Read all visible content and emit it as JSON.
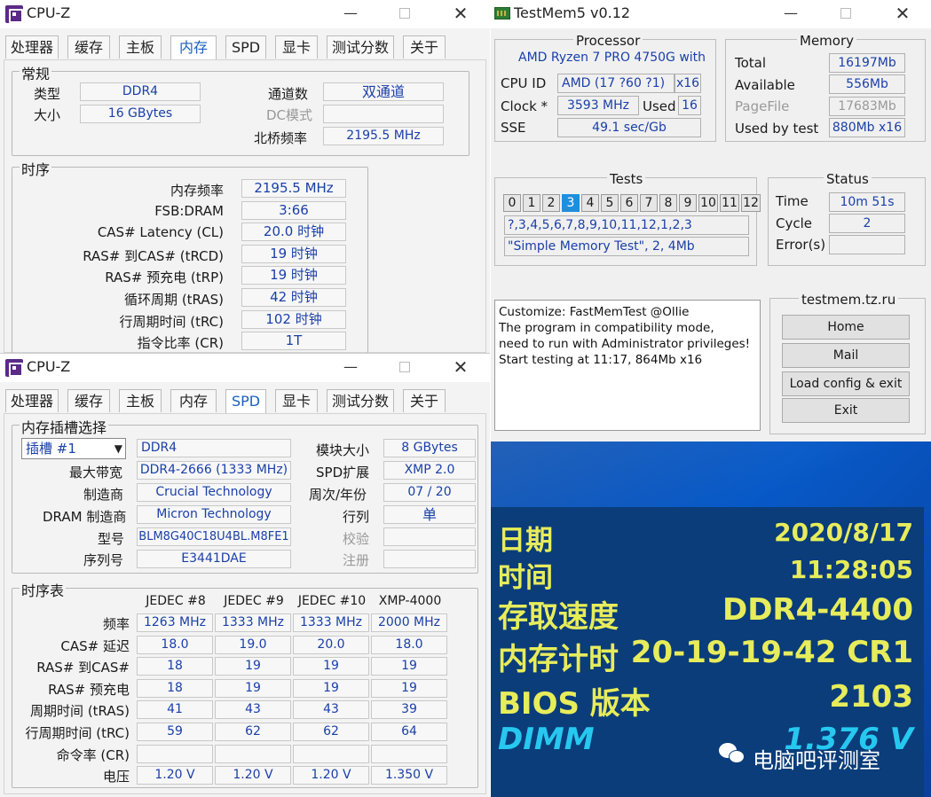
{
  "cpuz1": {
    "title": "CPU-Z",
    "tabs": [
      "处理器",
      "缓存",
      "主板",
      "内存",
      "SPD",
      "显卡",
      "测试分数",
      "关于"
    ],
    "general": {
      "label": "常规",
      "type_label": "类型",
      "type": "DDR4",
      "size_label": "大小",
      "size": "16 GBytes",
      "channels_label": "通道数",
      "channels": "双通道",
      "dc_label": "DC模式",
      "dc": "",
      "nb_label": "北桥频率",
      "nb": "2195.5 MHz"
    },
    "timings": {
      "label": "时序",
      "rows": [
        {
          "label": "内存频率",
          "value": "2195.5 MHz"
        },
        {
          "label": "FSB:DRAM",
          "value": "3:66"
        },
        {
          "label": "CAS# Latency (CL)",
          "value": "20.0 时钟"
        },
        {
          "label": "RAS# 到CAS# (tRCD)",
          "value": "19 时钟"
        },
        {
          "label": "RAS# 预充电 (tRP)",
          "value": "19 时钟"
        },
        {
          "label": "循环周期 (tRAS)",
          "value": "42 时钟"
        },
        {
          "label": "行周期时间 (tRC)",
          "value": "102 时钟"
        },
        {
          "label": "指令比率 (CR)",
          "value": "1T"
        }
      ]
    }
  },
  "cpuz2": {
    "title": "CPU-Z",
    "tabs": [
      "处理器",
      "缓存",
      "主板",
      "内存",
      "SPD",
      "显卡",
      "测试分数",
      "关于"
    ],
    "slot": {
      "label": "内存插槽选择",
      "select": "插槽 #1",
      "type": "DDR4",
      "module_size_label": "模块大小",
      "module_size": "8 GBytes",
      "max_bw_label": "最大带宽",
      "max_bw": "DDR4-2666 (1333 MHz)",
      "spd_ext_label": "SPD扩展",
      "spd_ext": "XMP 2.0",
      "maker_label": "制造商",
      "maker": "Crucial Technology",
      "week_label": "周次/年份",
      "week": "07 / 20",
      "dram_maker_label": "DRAM 制造商",
      "dram_maker": "Micron Technology",
      "rank_label": "行列",
      "rank": "单",
      "part_label": "型号",
      "part": "BLM8G40C18U4BL.M8FE1",
      "check_label": "校验",
      "check": "",
      "serial_label": "序列号",
      "serial": "E3441DAE",
      "reg_label": "注册",
      "reg": ""
    },
    "table": {
      "label": "时序表",
      "headers": [
        "JEDEC #8",
        "JEDEC #9",
        "JEDEC #10",
        "XMP-4000"
      ],
      "rows": [
        {
          "label": "频率",
          "values": [
            "1263 MHz",
            "1333 MHz",
            "1333 MHz",
            "2000 MHz"
          ]
        },
        {
          "label": "CAS# 延迟",
          "values": [
            "18.0",
            "19.0",
            "20.0",
            "18.0"
          ]
        },
        {
          "label": "RAS# 到CAS#",
          "values": [
            "18",
            "19",
            "19",
            "19"
          ]
        },
        {
          "label": "RAS# 预充电",
          "values": [
            "18",
            "19",
            "19",
            "19"
          ]
        },
        {
          "label": "周期时间 (tRAS)",
          "values": [
            "41",
            "43",
            "43",
            "39"
          ]
        },
        {
          "label": "行周期时间 (tRC)",
          "values": [
            "59",
            "62",
            "62",
            "64"
          ]
        },
        {
          "label": "命令率 (CR)",
          "values": [
            "",
            "",
            "",
            ""
          ]
        },
        {
          "label": "电压",
          "values": [
            "1.20 V",
            "1.20 V",
            "1.20 V",
            "1.350 V"
          ]
        }
      ]
    }
  },
  "testmem": {
    "title": "TestMem5 v0.12",
    "processor": {
      "label": "Processor",
      "name": "AMD Ryzen 7 PRO 4750G with",
      "cpuid_label": "CPU ID",
      "cpuid": "AMD  (17 ?60 ?1)",
      "threads": "x16",
      "clock_label": "Clock *",
      "clock": "3593 MHz",
      "used_label": "Used",
      "used": "16",
      "sse_label": "SSE",
      "sse": "49.1 sec/Gb"
    },
    "memory": {
      "label": "Memory",
      "total_label": "Total",
      "total": "16197Mb",
      "available_label": "Available",
      "available": "556Mb",
      "pagefile_label": "PageFile",
      "pagefile": "17683Mb",
      "usedby_label": "Used by test",
      "usedby": "880Mb x16"
    },
    "tests": {
      "label": "Tests",
      "cells": [
        "0",
        "1",
        "2",
        "3",
        "4",
        "5",
        "6",
        "7",
        "8",
        "9",
        "10",
        "11",
        "12"
      ],
      "active": "3",
      "sequence": "?,3,4,5,6,7,8,9,10,11,12,1,2,3",
      "current": "\"Simple Memory Test\", 2, 4Mb"
    },
    "status": {
      "label": "Status",
      "time_label": "Time",
      "time": "10m 51s",
      "cycle_label": "Cycle",
      "cycle": "2",
      "errors_label": "Error(s)",
      "errors": ""
    },
    "log": [
      "Customize: FastMemTest @Ollie",
      "The program in compatibility mode,",
      "need to run with Administrator privileges!",
      "Start testing at 11:17, 864Mb x16"
    ],
    "site": {
      "label": "testmem.tz.ru",
      "buttons": [
        "Home",
        "Mail",
        "Load config & exit",
        "Exit"
      ]
    }
  },
  "sysinfo": [
    {
      "key": "日期",
      "value": "2020/8/17"
    },
    {
      "key": "时间",
      "value": "11:28:05"
    },
    {
      "key": "存取速度",
      "value": "DDR4-4400"
    },
    {
      "key": "内存计时",
      "value": "20-19-19-42 CR1"
    },
    {
      "key": "BIOS 版本",
      "value": "2103"
    },
    {
      "key": "DIMM",
      "value": "1.376 V"
    }
  ],
  "watermark": "电脑吧评测室",
  "colors": {
    "accent": "#1e8fdd",
    "info_text": "#e7ec5b",
    "dimm_text": "#27c8f0",
    "value_text": "#1a3fa8"
  }
}
